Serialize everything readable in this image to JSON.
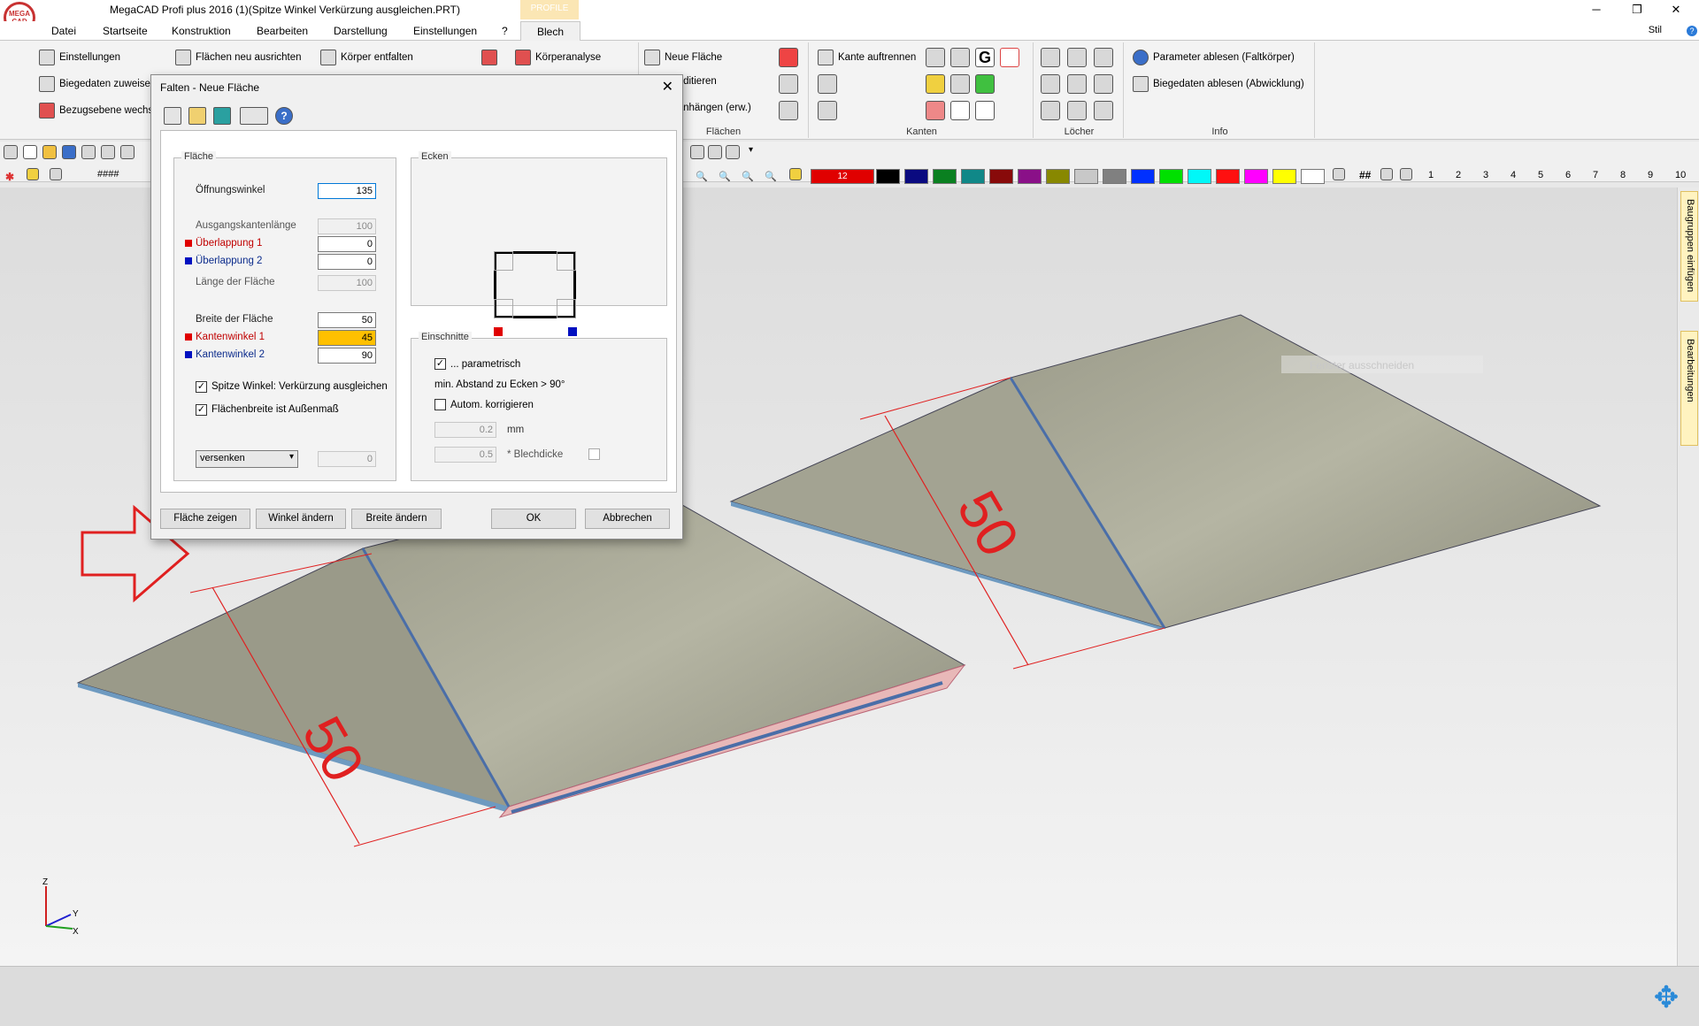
{
  "window": {
    "title": "MegaCAD Profi plus 2016 (1)(Spitze Winkel Verkürzung ausgleichen.PRT)",
    "logo_text": "MEGA CAD",
    "context_tab": "PROFILE",
    "min": "─",
    "max": "❐",
    "close": "✕"
  },
  "menu": {
    "items": [
      "Datei",
      "Startseite",
      "Konstruktion",
      "Bearbeiten",
      "Darstellung",
      "Einstellungen",
      "?"
    ],
    "active": "Blech",
    "stil": "Stil",
    "help": "?"
  },
  "ribbon": {
    "col1": [
      "Einstellungen",
      "Biegedaten zuweisen",
      "Bezugsebene wechseln"
    ],
    "col2": [
      "Flächen neu ausrichten"
    ],
    "col3": [
      "Körper entfalten"
    ],
    "col4": [
      "Körperanalyse"
    ],
    "flaechen": [
      "Neue Fläche",
      "Fläche editieren",
      "Fläche anhängen (erw.)"
    ],
    "kanten": [
      "Kante auftrennen"
    ],
    "info": [
      "Parameter ablesen (Faltkörper)",
      "Biegedaten ablesen (Abwicklung)"
    ],
    "groups": {
      "flaechen": "Flächen",
      "kanten": "Kanten",
      "loecher": "Löcher",
      "info": "Info"
    }
  },
  "toolbar": {
    "hashes": "####",
    "color_number": "12",
    "hash2": "##",
    "layers": [
      "1",
      "2",
      "3",
      "4",
      "5",
      "6",
      "7",
      "8",
      "9",
      "10"
    ],
    "colors": [
      "#e00000",
      "#000000",
      "#0a0a80",
      "#0a8020",
      "#108888",
      "#880a0a",
      "#8a1088",
      "#888800",
      "#c8c8c8",
      "#808080",
      "#0030ff",
      "#00e000",
      "#00f8f8",
      "#ff1010",
      "#ff00ff",
      "#ffff00",
      "#ffffff"
    ]
  },
  "dialog": {
    "title": "Falten - Neue Fläche",
    "flaeche": {
      "legend": "Fläche",
      "oeffnungswinkel_label": "Öffnungswinkel",
      "oeffnungswinkel": "135",
      "ausgangskante_label": "Ausgangskantenlänge",
      "ausgangskante": "100",
      "ueberlappung1_label": "Überlappung 1",
      "ueberlappung1": "0",
      "ueberlappung2_label": "Überlappung 2",
      "ueberlappung2": "0",
      "laenge_label": "Länge der Fläche",
      "laenge": "100",
      "breite_label": "Breite der Fläche",
      "breite": "50",
      "kantenwinkel1_label": "Kantenwinkel 1",
      "kantenwinkel1": "45",
      "kantenwinkel2_label": "Kantenwinkel 2",
      "kantenwinkel2": "90",
      "spitze_label": "Spitze Winkel: Verkürzung ausgleichen",
      "flaechenbreite_label": "Flächenbreite ist Außenmaß",
      "select": "versenken",
      "select_value": "0"
    },
    "ecken": {
      "legend": "Ecken"
    },
    "einschnitte": {
      "legend": "Einschnitte",
      "parametrisch": "... parametrisch",
      "min_abstand": "min. Abstand zu Ecken > 90°",
      "autom": "Autom. korrigieren",
      "val1": "0.2",
      "unit1": "mm",
      "val2": "0.5",
      "unit2": "* Blechdicke"
    },
    "buttons": {
      "zeigen": "Fläche zeigen",
      "winkel": "Winkel ändern",
      "breite": "Breite ändern",
      "ok": "OK",
      "abbrechen": "Abbrechen"
    }
  },
  "viewport": {
    "dim_left": "50",
    "dim_right": "50",
    "ghost_text": "Fenster ausschneiden",
    "axis": {
      "z": "Z",
      "y": "Y",
      "x": "X"
    }
  },
  "side": {
    "tab1": "Baugruppen einfügen",
    "tab2": "Bearbeitungen"
  }
}
